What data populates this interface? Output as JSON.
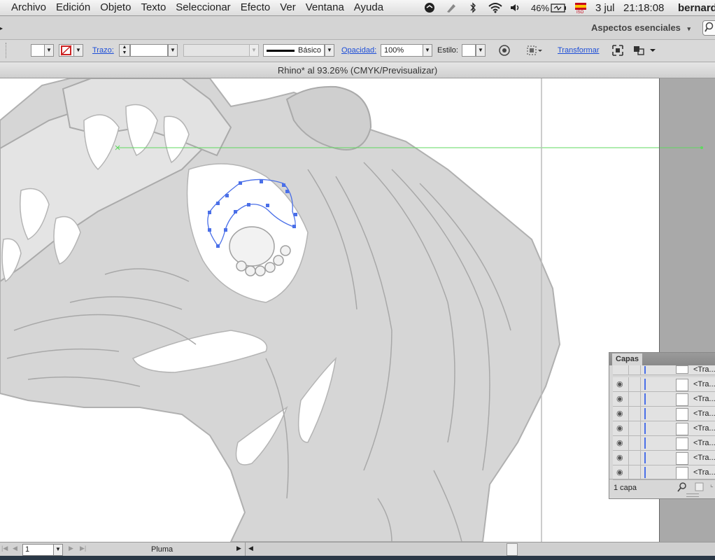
{
  "menubar": {
    "items": [
      "Archivo",
      "Edición",
      "Objeto",
      "Texto",
      "Seleccionar",
      "Efecto",
      "Ver",
      "Ventana",
      "Ayuda"
    ],
    "battery": "46%",
    "date": "3 jul",
    "time": "21:18:08",
    "user": "bernard"
  },
  "appbar": {
    "workspace": "Aspectos esenciales"
  },
  "control": {
    "stroke_label": "Trazo:",
    "brush": "Básico",
    "opacity_label": "Opacidad:",
    "opacity_value": "100%",
    "style_label": "Estilo:",
    "transform_label": "Transformar"
  },
  "document": {
    "title": "Rhino* al 93.26% (CMYK/Previsualizar)"
  },
  "layers": {
    "tab": "Capas",
    "rows": [
      "<Tra...",
      "<Tra...",
      "<Tra...",
      "<Tra...",
      "<Tra...",
      "<Tra...",
      "<Tra...",
      "<Tra..."
    ],
    "count": "1 capa"
  },
  "statusbar": {
    "artboard": "1",
    "tool": "Pluma"
  }
}
